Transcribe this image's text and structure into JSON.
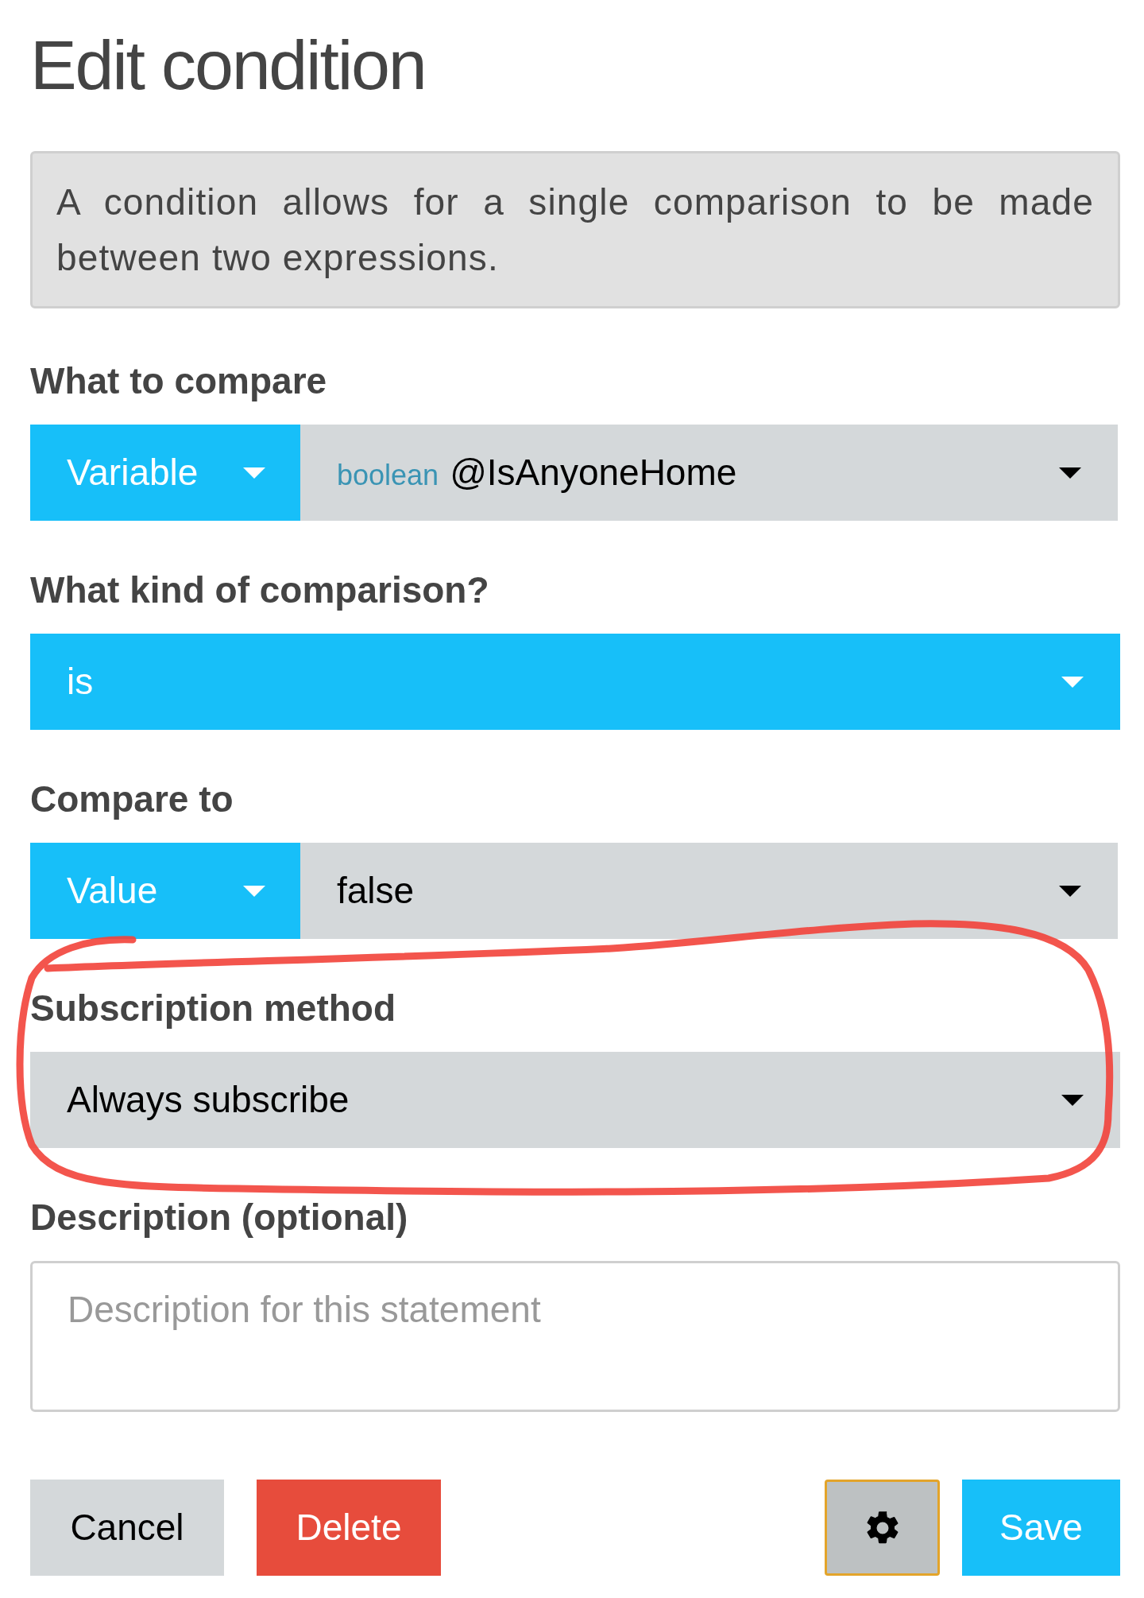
{
  "title": "Edit condition",
  "info": "A condition allows for a single comparison to be made between two expressions.",
  "fields": [
    {
      "label": "What to compare",
      "kind": "split",
      "mode": "Variable",
      "type_hint": "boolean",
      "value": "@IsAnyoneHome"
    },
    {
      "label": "What kind of comparison?",
      "kind": "accent_select",
      "value": "is"
    },
    {
      "label": "Compare to",
      "kind": "split",
      "mode": "Value",
      "value": "false"
    },
    {
      "label": "Subscription method",
      "kind": "select",
      "value": "Always subscribe"
    },
    {
      "label": "Description (optional)",
      "kind": "textarea",
      "placeholder": "Description for this statement"
    }
  ],
  "buttons": [
    {
      "label": "Cancel",
      "kind": "cancel"
    },
    {
      "label": "Delete",
      "kind": "delete"
    },
    {
      "kind": "settings"
    },
    {
      "label": "Save",
      "kind": "save"
    }
  ]
}
